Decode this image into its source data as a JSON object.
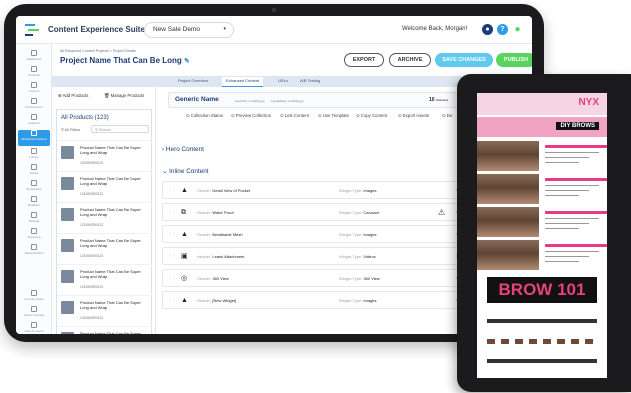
{
  "app": {
    "title": "Content Experience Suite",
    "demo_select": "New Sale Demo",
    "welcome": "Welcome Back, Morgan!"
  },
  "nav": [
    {
      "label": "Dashboard"
    },
    {
      "label": "Products"
    },
    {
      "label": "Content"
    },
    {
      "label": "Performance"
    },
    {
      "label": "Analytics"
    },
    {
      "label": "Enhanced Content"
    },
    {
      "label": "Library"
    },
    {
      "label": "Assets"
    },
    {
      "label": "Syndication"
    },
    {
      "label": "Retailers"
    },
    {
      "label": "Settings"
    },
    {
      "label": "Reporting"
    },
    {
      "label": "Administration"
    },
    {
      "label": "Account Setup"
    },
    {
      "label": "Admin Training"
    },
    {
      "label": "Help & Logout"
    }
  ],
  "header": {
    "breadcrumb": "All Enhanced Content Projects > Project Details",
    "project_title": "Project Name That Can Be Long",
    "btn_export": "EXPORT",
    "btn_archive": "ARCHIVE",
    "btn_save": "SAVE CHANGES",
    "btn_publish": "PUBLISH"
  },
  "tabs": [
    "Project Overview",
    "Enhanced Content",
    "URLs",
    "A/B Testing"
  ],
  "products": {
    "add_label": "Add Products",
    "manage_label": "Manage Products",
    "title": "All Products (123)",
    "filters_label": "All Filters",
    "search_placeholder": "Search",
    "items": [
      {
        "name": "Product Name That Can Be Super Long and Wrap",
        "sku": "1234567890123"
      },
      {
        "name": "Product Name That Can Be Super Long and Wrap",
        "sku": "1234567890123"
      },
      {
        "name": "Product Name That Can Be Super Long and Wrap",
        "sku": "1234567890123"
      },
      {
        "name": "Product Name That Can Be Super Long and Wrap",
        "sku": "1234567890123"
      },
      {
        "name": "Product Name That Can Be Super Long and Wrap",
        "sku": "1234567890123"
      },
      {
        "name": "Product Name That Can Be Super Long and Wrap",
        "sku": "1234567890123"
      },
      {
        "name": "Product Name That Can Be Super Long and Wrap",
        "sku": "1234567890123"
      }
    ]
  },
  "generic": {
    "name": "Generic Name",
    "last_pub": "Last Pub: mm/dd/yyyy",
    "last_edited": "Last Edited: mm/dd/yyyy",
    "count": "10",
    "count_label": "Websites"
  },
  "actions": [
    "Collection Status",
    "Preview Collection",
    "Link Content",
    "Use Template",
    "Copy Content",
    "Export Assets",
    "De"
  ],
  "sections": {
    "hero": "Hero Content",
    "inline": "Inline Content"
  },
  "widgets": [
    {
      "header": "Detail View of Pocket",
      "type": "Images",
      "icon": "image-icon",
      "warn": false
    },
    {
      "header": "Water Proof",
      "type": "Carousel",
      "icon": "carousel-icon",
      "warn": true
    },
    {
      "header": "Breathable Mesh",
      "type": "Images",
      "icon": "image-icon",
      "warn": false
    },
    {
      "header": "Leash Attachment",
      "type": "Videos",
      "icon": "video-icon",
      "warn": false
    },
    {
      "header": "360 View",
      "type": "360 View",
      "icon": "360-icon",
      "warn": false
    },
    {
      "header": "[New Widget]",
      "type": "Images",
      "icon": "image-icon",
      "warn": false
    }
  ],
  "widget_labels": {
    "header": "Header:",
    "type": "Widget Type:"
  },
  "tablet": {
    "logo": "NYX",
    "banner": "DIY BROWS",
    "big": "BROW 101"
  },
  "colors": {
    "primary": "#1b3c78",
    "accent": "#2e9be8",
    "save": "#5fc9f0",
    "publish": "#5bd45f",
    "brand_pink": "#e8407e"
  }
}
